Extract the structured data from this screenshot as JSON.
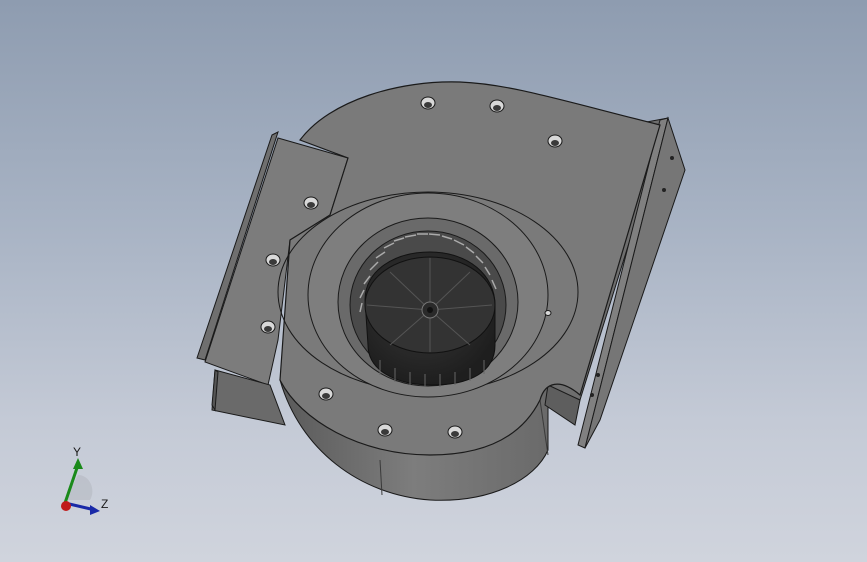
{
  "viewport": {
    "background_top": "#8e9cb0",
    "background_bottom": "#d0d4dd"
  },
  "model": {
    "body_color": "#7a7a7a",
    "shadow_color": "#5e5e5e",
    "light_color": "#8c8c8c",
    "impeller_color": "#2b2b2b",
    "edge_color": "#1a1a1a"
  },
  "triad": {
    "y_label": "Y",
    "z_label": "Z",
    "y_color": "#1a8a1a",
    "z_color": "#1a2aa8",
    "x_color": "#c01a1a"
  }
}
